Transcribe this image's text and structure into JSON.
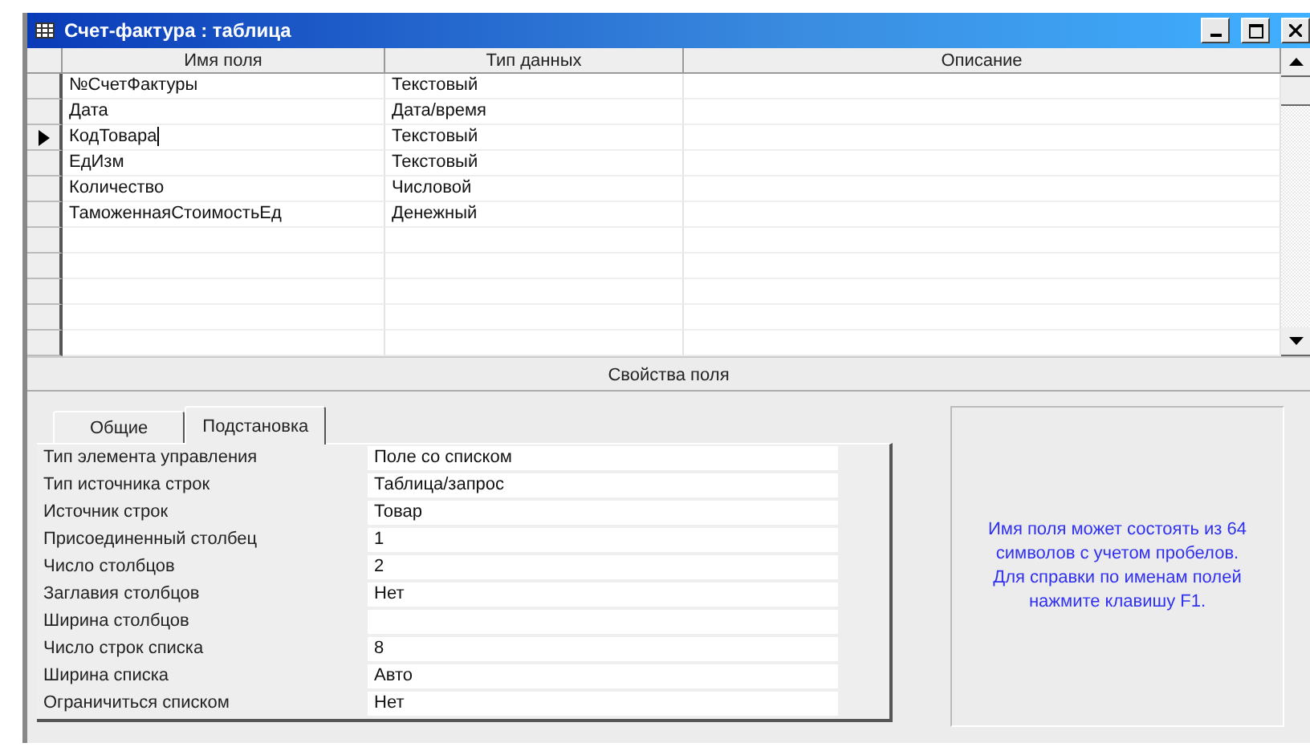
{
  "window": {
    "title": "Счет-фактура : таблица"
  },
  "table": {
    "columns": [
      "Имя поля",
      "Тип данных",
      "Описание"
    ],
    "rows": [
      {
        "field_name": "№СчетФактуры",
        "data_type": "Текстовый",
        "selected": false
      },
      {
        "field_name": "Дата",
        "data_type": "Дата/время",
        "selected": false
      },
      {
        "field_name": "КодТовара",
        "data_type": "Текстовый",
        "selected": true
      },
      {
        "field_name": "ЕдИзм",
        "data_type": "Текстовый",
        "selected": false
      },
      {
        "field_name": "Количество",
        "data_type": "Числовой",
        "selected": false
      },
      {
        "field_name": "ТаможеннаяСтоимостьЕд",
        "data_type": "Денежный",
        "selected": false
      },
      {
        "selected": false
      },
      {
        "selected": false
      },
      {
        "selected": false
      },
      {
        "selected": false
      },
      {
        "selected": false
      }
    ]
  },
  "properties_title": "Свойства поля",
  "tabs": [
    {
      "label": "Общие",
      "selected": false
    },
    {
      "label": "Подстановка",
      "selected": true
    }
  ],
  "properties": [
    {
      "label": "Тип элемента управления",
      "value": "Поле со списком"
    },
    {
      "label": "Тип источника строк",
      "value": "Таблица/запрос"
    },
    {
      "label": "Источник строк",
      "value": "Товар"
    },
    {
      "label": "Присоединенный столбец",
      "value": "1"
    },
    {
      "label": "Число столбцов",
      "value": "2"
    },
    {
      "label": "Заглавия столбцов",
      "value": "Нет"
    },
    {
      "label": "Ширина столбцов"
    },
    {
      "label": "Число строк списка",
      "value": "8"
    },
    {
      "label": "Ширина списка",
      "value": "Авто"
    },
    {
      "label": "Ограничиться списком",
      "value": "Нет"
    }
  ],
  "help_text": "Имя поля может состоять из 64 символов с учетом пробелов.  Для справки по именам полей нажмите клавишу F1."
}
